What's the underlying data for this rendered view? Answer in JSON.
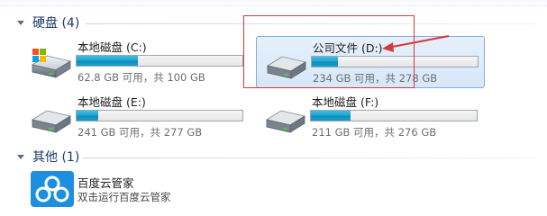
{
  "hdd_group": {
    "title": "硬盘 (4)"
  },
  "other_group": {
    "title": "其他 (1)"
  },
  "drives": [
    {
      "label": "本地磁盘 (C:)",
      "info": "62.8 GB 可用，共 100 GB",
      "used_fraction": 0.37
    },
    {
      "label": "公司文件 (D:)",
      "info": "234 GB 可用，共 278 GB",
      "used_fraction": 0.16
    },
    {
      "label": "本地磁盘 (E:)",
      "info": "241 GB 可用，共 277 GB",
      "used_fraction": 0.13
    },
    {
      "label": "本地磁盘 (F:)",
      "info": "211 GB 可用，共 276 GB",
      "used_fraction": 0.24
    }
  ],
  "apps": [
    {
      "name": "百度云管家",
      "description": "双击运行百度云管家"
    }
  ],
  "colors": {
    "annotation": "#d23a3a",
    "bar_fill": "#1b9fcb",
    "selection": "#d7e7f9"
  },
  "icons": {
    "drive": "hard-drive-icon",
    "windows": "windows-logo-icon",
    "app": "baidu-cloud-icon"
  }
}
